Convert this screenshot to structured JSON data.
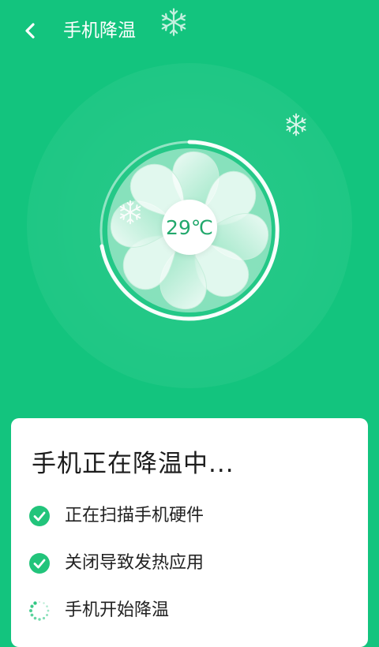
{
  "header": {
    "title": "手机降温",
    "back_icon": "chevron-left-icon"
  },
  "cooling": {
    "temperature": "29℃"
  },
  "card": {
    "title": "手机正在降温中...",
    "tasks": [
      {
        "label": "正在扫描手机硬件",
        "status": "done",
        "icon": "check-circle-icon"
      },
      {
        "label": "关闭导致发热应用",
        "status": "done",
        "icon": "check-circle-icon"
      },
      {
        "label": "手机开始降温",
        "status": "in-progress",
        "icon": "loading-spinner-icon"
      }
    ]
  },
  "colors": {
    "background": "#13c47e",
    "accent": "#22a86c",
    "card": "#ffffff"
  }
}
